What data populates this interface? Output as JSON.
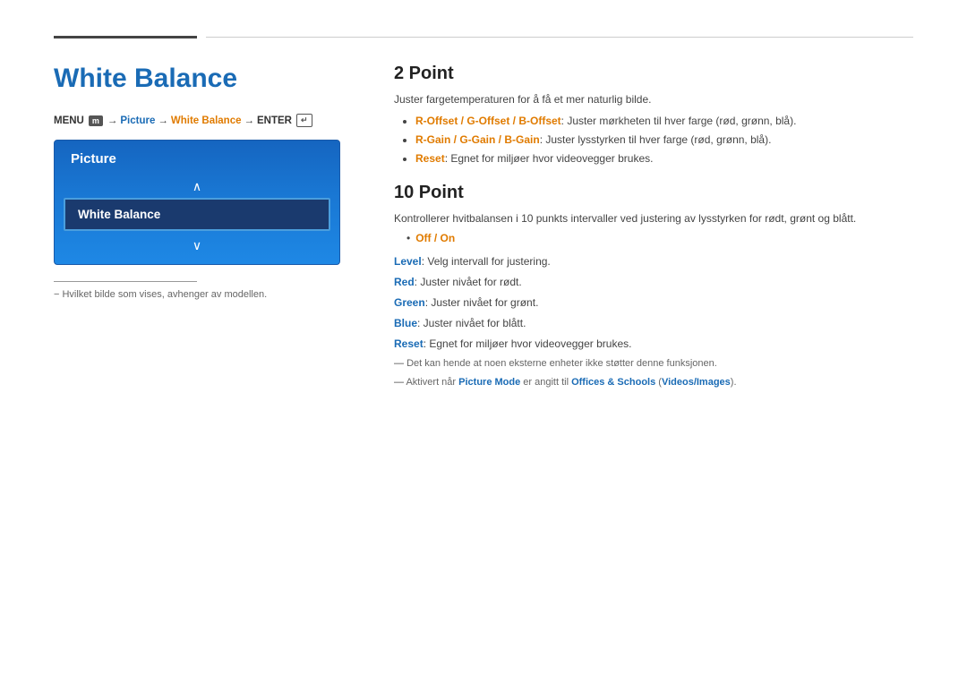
{
  "top_rule": {},
  "left": {
    "title": "White Balance",
    "menu_path": {
      "prefix": "MENU",
      "menu_box": "m",
      "arrow1": "→",
      "picture": "Picture",
      "arrow2": "→",
      "white_balance": "White Balance",
      "arrow3": "→",
      "enter": "ENTER",
      "enter_icon": "↵"
    },
    "picture_menu": {
      "header": "Picture",
      "up_arrow": "∧",
      "selected": "White Balance",
      "down_arrow": "∨"
    },
    "footnote_rule": true,
    "footnote": "− Hvilket bilde som vises, avhenger av modellen."
  },
  "right": {
    "section1": {
      "title": "2 Point",
      "intro": "Juster fargetemperaturen for å få et mer naturlig bilde.",
      "bullets": [
        {
          "orange_part": "R-Offset / G-Offset / B-Offset",
          "rest": ": Juster mørkheten til hver farge (rød, grønn, blå)."
        },
        {
          "orange_part": "R-Gain / G-Gain / B-Gain",
          "rest": ": Juster lysstyrken til hver farge (rød, grønn, blå)."
        },
        {
          "orange_part": "Reset",
          "rest": ": Egnet for miljøer hvor videovegger brukes."
        }
      ]
    },
    "section2": {
      "title": "10 Point",
      "intro": "Kontrollerer hvitbalansen i 10 punkts intervaller ved justering av lysstyrken for rødt, grønt og blått.",
      "sub_bullet": "Off / On",
      "fields": [
        {
          "label": "Level",
          "text": ": Velg intervall for justering."
        },
        {
          "label": "Red",
          "text": ": Juster nivået for rødt."
        },
        {
          "label": "Green",
          "text": ": Juster nivået for grønt."
        },
        {
          "label": "Blue",
          "text": ": Juster nivået for blått."
        },
        {
          "label": "Reset",
          "text": ": Egnet for miljøer hvor videovegger brukes."
        }
      ],
      "notes": [
        "Det kan hende at noen eksterne enheter ikke støtter denne funksjonen.",
        {
          "prefix": "Aktivert når ",
          "highlight1": "Picture Mode",
          "mid": " er angitt til ",
          "highlight2": "Offices & Schools",
          "sep": " (",
          "highlight3": "Videos/Images",
          "suffix": ")."
        }
      ]
    }
  }
}
